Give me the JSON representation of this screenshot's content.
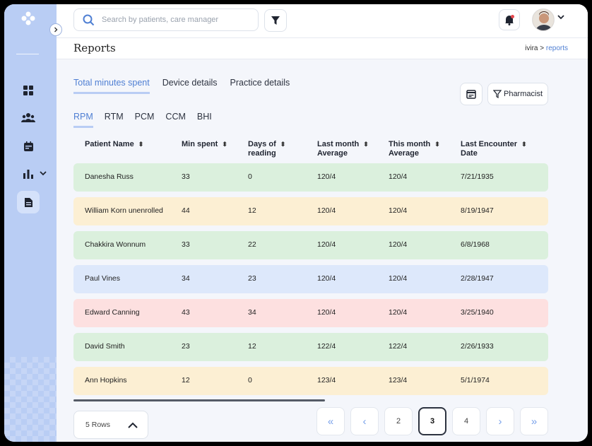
{
  "search": {
    "placeholder": "Search by patients, care manager"
  },
  "header": {
    "title": "Reports",
    "breadcrumb_root": "ivira",
    "breadcrumb_sep": ">",
    "breadcrumb_current": "reports"
  },
  "tabs": [
    {
      "label": "Total minutes spent",
      "active": true
    },
    {
      "label": "Device details",
      "active": false
    },
    {
      "label": "Practice details",
      "active": false
    }
  ],
  "subtabs": [
    {
      "label": "RPM",
      "active": true
    },
    {
      "label": "RTM",
      "active": false
    },
    {
      "label": "PCM",
      "active": false
    },
    {
      "label": "CCM",
      "active": false
    },
    {
      "label": "BHI",
      "active": false
    }
  ],
  "toolbar": {
    "pharmacist_label": "Pharmacist"
  },
  "table": {
    "columns": [
      {
        "line1": "Patient Name",
        "line2": ""
      },
      {
        "line1": "Min spent",
        "line2": ""
      },
      {
        "line1": "Days of",
        "line2": "reading"
      },
      {
        "line1": "Last month",
        "line2": "Average"
      },
      {
        "line1": "This month",
        "line2": "Average"
      },
      {
        "line1": "Last Encounter",
        "line2": "Date"
      }
    ],
    "sort_glyph": "⬍",
    "rows": [
      {
        "cells": [
          "Danesha Russ",
          "33",
          "0",
          "120/4",
          "120/4",
          "7/21/1935"
        ],
        "color": "#dbf0dd"
      },
      {
        "cells": [
          "William Korn unenrolled",
          "44",
          "12",
          "120/4",
          "120/4",
          "8/19/1947"
        ],
        "color": "#fcefd3"
      },
      {
        "cells": [
          "Chakkira Wonnum",
          "33",
          "22",
          "120/4",
          "120/4",
          "6/8/1968"
        ],
        "color": "#dbf0dd"
      },
      {
        "cells": [
          "Paul Vines",
          "34",
          "23",
          "120/4",
          "120/4",
          "2/28/1947"
        ],
        "color": "#dde8fb"
      },
      {
        "cells": [
          "Edward Canning",
          "43",
          "34",
          "120/4",
          "120/4",
          "3/25/1940"
        ],
        "color": "#fde0e0"
      },
      {
        "cells": [
          "David Smith",
          "23",
          "12",
          "122/4",
          "122/4",
          "2/26/1933"
        ],
        "color": "#dbf0dd"
      },
      {
        "cells": [
          "Ann Hopkins",
          "12",
          "0",
          "123/4",
          "123/4",
          "5/1/1974"
        ],
        "color": "#fcefd3"
      }
    ]
  },
  "footer": {
    "rows_label": "5 Rows",
    "pagination": {
      "first": "«",
      "prev": "‹",
      "pages": [
        "2",
        "3",
        "4"
      ],
      "current": "3",
      "next": "›",
      "last": "»"
    }
  },
  "colors": {
    "accent": "#4f7fd3",
    "sidebar": "#b9cdf4",
    "notification_dot": "#e5484d"
  },
  "icons": [
    "logo-icon",
    "collapse-chevron-icon",
    "dashboard-icon",
    "patients-icon",
    "calendar-icon",
    "reports-chart-icon",
    "document-icon",
    "search-icon",
    "filter-icon",
    "bell-icon",
    "calendar-icon",
    "filter-icon",
    "chevron-up-icon"
  ]
}
